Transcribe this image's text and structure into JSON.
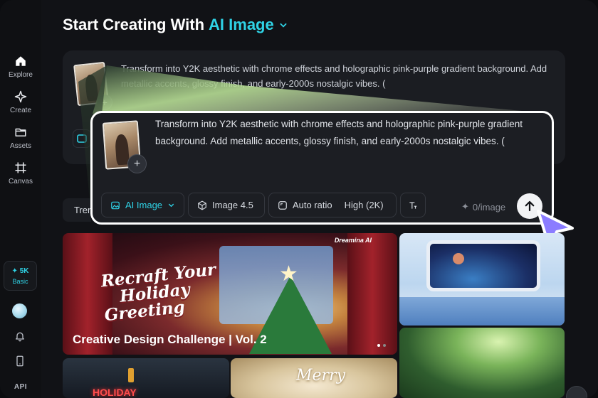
{
  "sidebar": {
    "items": [
      {
        "label": "Explore",
        "icon": "home-icon"
      },
      {
        "label": "Create",
        "icon": "sparkle-icon"
      },
      {
        "label": "Assets",
        "icon": "folder-icon"
      },
      {
        "label": "Canvas",
        "icon": "grid-icon"
      }
    ],
    "credits": {
      "amount": "5K",
      "plan": "Basic"
    },
    "api_label": "API"
  },
  "header": {
    "title_prefix": "Start Creating With",
    "title_accent": "AI Image"
  },
  "prompt": {
    "text": "Transform into Y2K aesthetic with chrome effects and holographic pink-purple gradient background. Add metallic accents, glossy finish, and early-2000s nostalgic vibes. (",
    "add_label": "+",
    "model_label": "AI Image",
    "version_label": "Image 4.5",
    "ratio_label": "Auto ratio",
    "resolution_label": "High (2K)",
    "cost_label": "0/image"
  },
  "tabs": {
    "trending_label": "Trending"
  },
  "gallery": {
    "feature": {
      "caption": "Creative Design Challenge | Vol. 2",
      "script_line1": "Recraft Your",
      "script_line2": "Holiday",
      "script_line3": "Greeting",
      "brand": "Dreamina AI"
    },
    "street_sign": "HOLIDAY",
    "merry_text": "Merry"
  },
  "colors": {
    "accent": "#2fd3e6",
    "cursor": "#8b7cff",
    "background": "#111216"
  }
}
